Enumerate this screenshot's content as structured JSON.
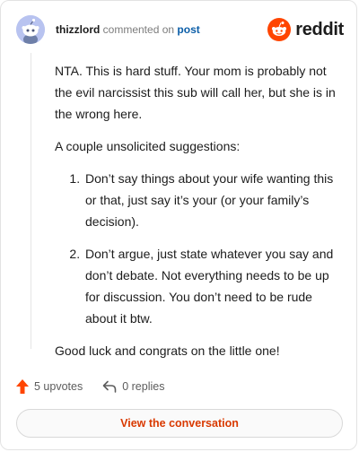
{
  "header": {
    "username": "thizzlord",
    "action_text": "commented on",
    "post_link": "post",
    "logo_text": "reddit"
  },
  "comment": {
    "intro": "NTA. This is hard stuff. Your mom is probably not the evil narcissist this sub will call her, but she is in the wrong here.",
    "lead": "A couple unsolicited suggestions:",
    "suggestions": [
      "Don’t say things about your wife wanting this or that, just say it’s your (or your family’s decision).",
      "Don’t argue, just state whatever you say and don’t debate. Not everything needs to be up for discussion. You don’t need to be rude about it btw."
    ],
    "closing": "Good luck and congrats on the little one!"
  },
  "footer": {
    "upvotes": "5 upvotes",
    "replies": "0 replies",
    "cta": "View the conversation"
  },
  "colors": {
    "brand": "#ff4500",
    "link": "#0b5ea8",
    "cta_text": "#d93900"
  },
  "icons": {
    "avatar": "snoo-avatar-icon",
    "logo": "reddit-snoo-icon",
    "upvote": "upvote-arrow-icon",
    "reply": "reply-arrow-icon"
  }
}
